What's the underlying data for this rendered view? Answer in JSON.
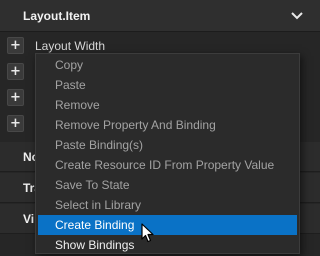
{
  "section": {
    "title": "Layout.Item",
    "collapse_icon": "chevron-down-icon"
  },
  "properties": [
    {
      "label": "Layout Width"
    }
  ],
  "plus_symbol": "+",
  "sub_sections": [
    {
      "title": "No"
    },
    {
      "title": "Tra"
    },
    {
      "title": "Vi"
    }
  ],
  "context_menu": {
    "items": [
      {
        "label": "Copy",
        "enabled": false
      },
      {
        "label": "Paste",
        "enabled": false
      },
      {
        "label": "Remove",
        "enabled": false
      },
      {
        "label": "Remove Property And Binding",
        "enabled": false
      },
      {
        "label": "Paste Binding(s)",
        "enabled": false
      },
      {
        "label": "Create Resource ID From Property Value",
        "enabled": false
      },
      {
        "label": "Save To State",
        "enabled": false
      },
      {
        "label": "Select in Library",
        "enabled": false
      },
      {
        "label": "Create Binding",
        "enabled": true,
        "selected": true
      },
      {
        "label": "Show Bindings",
        "enabled": true
      }
    ]
  },
  "colors": {
    "panel_bg": "#262626",
    "menu_bg": "#2b2b2b",
    "selection": "#0a72c6",
    "disabled_text": "#a3a3a3",
    "enabled_text": "#f0f0f0"
  }
}
